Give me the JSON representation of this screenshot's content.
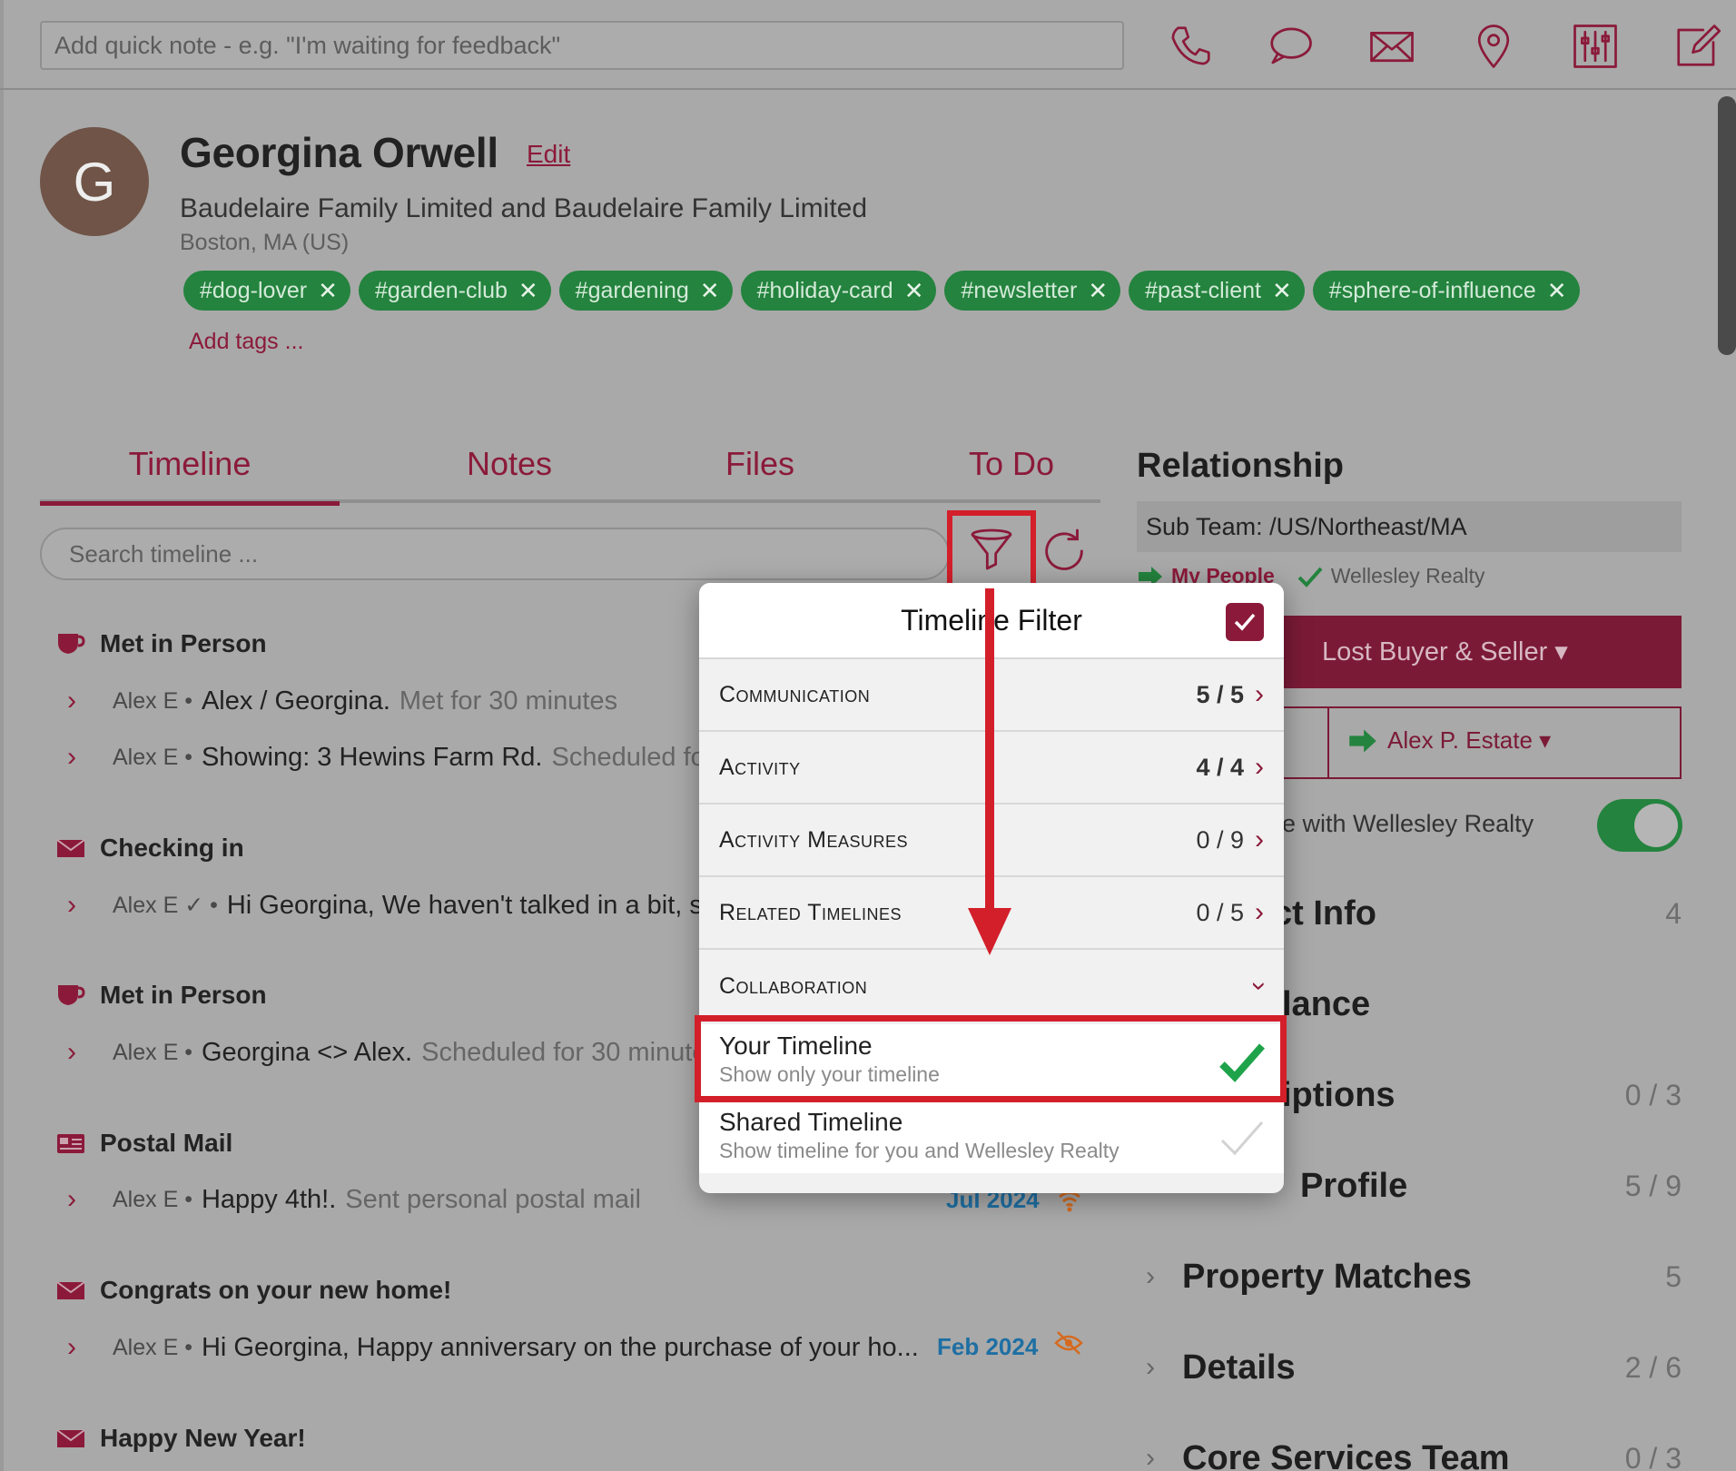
{
  "toolbar": {
    "quick_note_placeholder": "Add quick note - e.g. \"I'm waiting for feedback\"",
    "icons": [
      "phone-icon",
      "chat-icon",
      "mail-icon",
      "location-pin-icon",
      "sliders-icon",
      "compose-icon"
    ]
  },
  "contact": {
    "initial": "G",
    "name": "Georgina Orwell",
    "edit_label": "Edit",
    "company": "Baudelaire Family Limited and Baudelaire Family Limited",
    "location": "Boston, MA (US)",
    "tags": [
      "#dog-lover",
      "#garden-club",
      "#gardening",
      "#holiday-card",
      "#newsletter",
      "#past-client",
      "#sphere-of-influence"
    ],
    "add_tags_label": "Add tags ..."
  },
  "tabs": [
    "Timeline",
    "Notes",
    "Files",
    "To Do"
  ],
  "search": {
    "placeholder": "Search timeline ..."
  },
  "timeline": [
    {
      "title": "Met in Person",
      "rows": [
        {
          "who": "Alex E •",
          "text": "Alex / Georgina.",
          "detail": "Met for 30 minutes"
        },
        {
          "who": "Alex E •",
          "text": "Showing: 3 Hewins Farm Rd.",
          "detail": "Scheduled for"
        }
      ]
    },
    {
      "title": "Checking in",
      "rows": [
        {
          "who": "Alex E ✓ •",
          "text": "Hi Georgina, We haven't talked in a bit, s",
          "detail": ""
        }
      ]
    },
    {
      "title": "Met in Person",
      "rows": [
        {
          "who": "Alex E •",
          "text": "Georgina <> Alex.",
          "detail": "Scheduled for 30 minute"
        }
      ]
    },
    {
      "title": "Postal Mail",
      "rows": [
        {
          "who": "Alex E •",
          "text": "Happy 4th!.",
          "detail": "Sent personal postal mail",
          "date": "Jul 2024"
        }
      ]
    },
    {
      "title": "Congrats on your new home!",
      "rows": [
        {
          "who": "Alex E •",
          "text": "Hi Georgina, Happy anniversary on the purchase of your ho...",
          "detail": "",
          "date": "Feb 2024"
        }
      ]
    },
    {
      "title": "Happy New Year!",
      "rows": []
    }
  ],
  "relationship": {
    "title": "Relationship",
    "sub_team": "Sub Team: /US/Northeast/MA",
    "my_people": "My People",
    "org": "Wellesley Realty",
    "stage": "Lost Buyer & Seller ▾",
    "agent": "Alex P. Estate ▾",
    "share_label": "e with Wellesley Realty",
    "sections": [
      {
        "title": "ct Info",
        "count": "4"
      },
      {
        "title": "lance",
        "count": ""
      },
      {
        "title": "iptions",
        "count": "0 / 3"
      },
      {
        "title": "Profile",
        "count": "5 / 9"
      },
      {
        "title": "Property Matches",
        "count": "5"
      },
      {
        "title": "Details",
        "count": "2 / 6"
      },
      {
        "title": "Core Services Team",
        "count": "0 / 3"
      }
    ]
  },
  "filter": {
    "title": "Timeline Filter",
    "rows": [
      {
        "label": "Communication",
        "count": "5 / 5",
        "bold": true
      },
      {
        "label": "Activity",
        "count": "4 / 4",
        "bold": true
      },
      {
        "label": "Activity Measures",
        "count": "0 / 9",
        "bold": false
      },
      {
        "label": "Related Timelines",
        "count": "0 / 5",
        "bold": false
      }
    ],
    "collab_label": "Collaboration",
    "options": [
      {
        "title": "Your Timeline",
        "subtitle": "Show only your timeline",
        "checked": true
      },
      {
        "title": "Shared Timeline",
        "subtitle": "Show timeline for you and Wellesley Realty",
        "checked": false
      }
    ]
  },
  "colors": {
    "brand": "#8b1a3a",
    "tag_green": "#24833e",
    "highlight_red": "#d31f2a",
    "check_green": "#1fa34a",
    "date_blue": "#1e6fa3"
  }
}
